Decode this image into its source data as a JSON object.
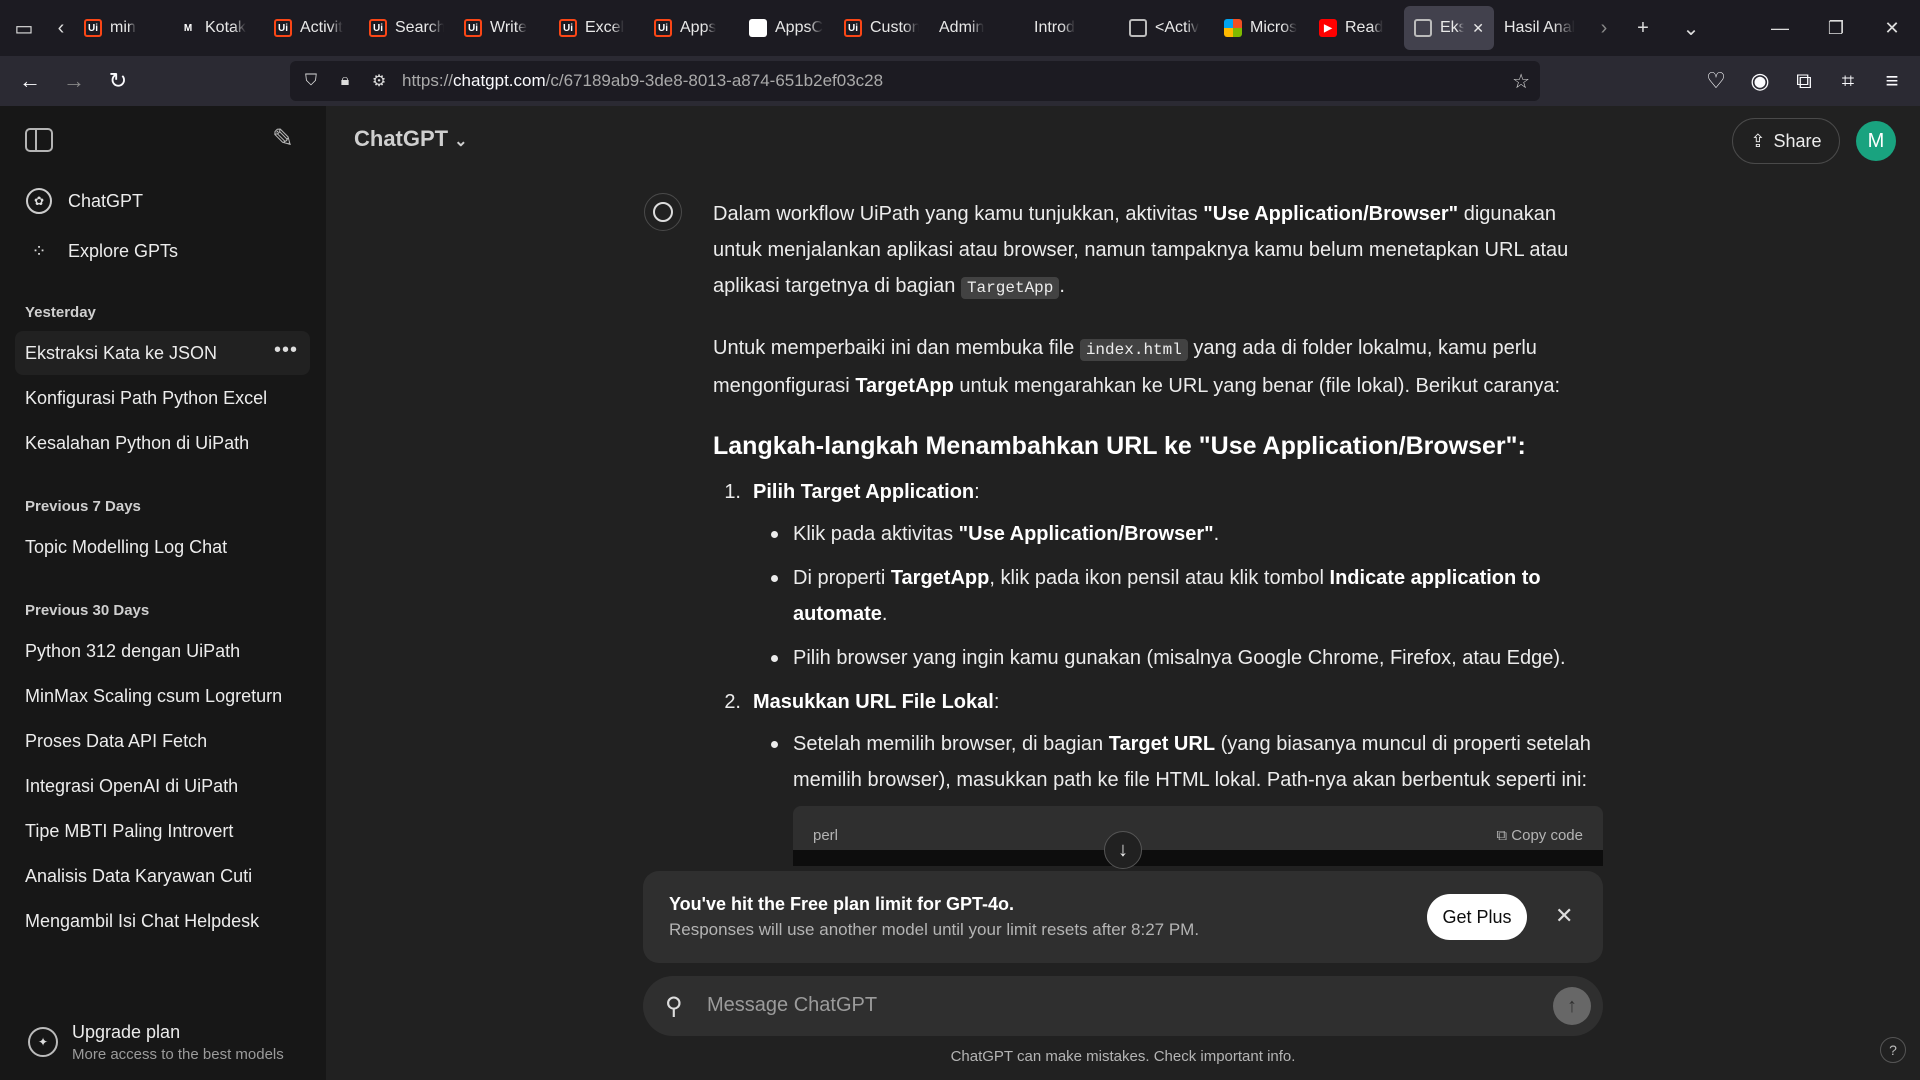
{
  "browser": {
    "tabs": [
      {
        "label": "min",
        "favicon": "uipath-icon"
      },
      {
        "label": "Kotak",
        "favicon": "gmail-icon"
      },
      {
        "label": "Activit",
        "favicon": "uipath-icon"
      },
      {
        "label": "Search",
        "favicon": "uipath-icon"
      },
      {
        "label": "Write",
        "favicon": "uipath-icon"
      },
      {
        "label": "Excel",
        "favicon": "uipath-icon"
      },
      {
        "label": "Apps",
        "favicon": "uipath-icon"
      },
      {
        "label": "AppsC",
        "favicon": "github-icon"
      },
      {
        "label": "Custon",
        "favicon": "uipath-icon"
      },
      {
        "label": "Admin",
        "favicon": "none"
      },
      {
        "label": "Introd",
        "favicon": "none"
      },
      {
        "label": "<Activ",
        "favicon": "openai-icon"
      },
      {
        "label": "Micros",
        "favicon": "microsoft-icon"
      },
      {
        "label": "Read",
        "favicon": "youtube-icon"
      },
      {
        "label": "Eks",
        "favicon": "openai-icon",
        "active": true
      },
      {
        "label": "Hasil Anal",
        "favicon": "none"
      }
    ],
    "url_prefix": "https://",
    "url_host": "chatgpt.com",
    "url_path": "/c/67189ab9-3de8-8013-a874-651b2ef03c28"
  },
  "sidebar": {
    "links": [
      {
        "label": "ChatGPT",
        "icon": "openai-icon"
      },
      {
        "label": "Explore GPTs",
        "icon": "grid-icon"
      }
    ],
    "sections": [
      {
        "title": "Yesterday",
        "items": [
          "Ekstraksi Kata ke JSON",
          "Konfigurasi Path Python Excel",
          "Kesalahan Python di UiPath"
        ]
      },
      {
        "title": "Previous 7 Days",
        "items": [
          "Topic Modelling Log Chat"
        ]
      },
      {
        "title": "Previous 30 Days",
        "items": [
          "Python 312 dengan UiPath",
          "MinMax Scaling csum Logreturn",
          "Proses Data API Fetch",
          "Integrasi OpenAI di UiPath",
          "Tipe MBTI Paling Introvert",
          "Analisis Data Karyawan Cuti",
          "Mengambil Isi Chat Helpdesk"
        ]
      }
    ],
    "upgrade_title": "Upgrade plan",
    "upgrade_sub": "More access to the best models"
  },
  "header": {
    "model": "ChatGPT",
    "share": "Share",
    "avatar_letter": "M"
  },
  "message": {
    "p1_a": "Dalam workflow UiPath yang kamu tunjukkan, aktivitas ",
    "p1_b": "\"Use Application/Browser\"",
    "p1_c": " digunakan untuk menjalankan aplikasi atau browser, namun tampaknya kamu belum menetapkan URL atau aplikasi targetnya di bagian ",
    "p1_code": "TargetApp",
    "p1_d": ".",
    "p2_a": "Untuk memperbaiki ini dan membuka file ",
    "p2_code": "index.html",
    "p2_b": " yang ada di folder lokalmu, kamu perlu mengonfigurasi ",
    "p2_c": "TargetApp",
    "p2_d": " untuk mengarahkan ke URL yang benar (file lokal). Berikut caranya:",
    "h_a": "Langkah-langkah Menambahkan URL ke ",
    "h_b": "\"Use Application/Browser\"",
    "h_c": ":",
    "s1_num": "1.",
    "s1_title": "Pilih Target Application",
    "s1_b1_a": "Klik pada aktivitas ",
    "s1_b1_b": "\"Use Application/Browser\"",
    "s1_b1_c": ".",
    "s1_b2_a": "Di properti ",
    "s1_b2_b": "TargetApp",
    "s1_b2_c": ", klik pada ikon pensil atau klik tombol ",
    "s1_b2_d": "Indicate application to automate",
    "s1_b2_e": ".",
    "s1_b3": "Pilih browser yang ingin kamu gunakan (misalnya Google Chrome, Firefox, atau Edge).",
    "s2_num": "2.",
    "s2_title": "Masukkan URL File Lokal",
    "s2_b1_a": "Setelah memilih browser, di bagian ",
    "s2_b1_b": "Target URL",
    "s2_b1_c": " (yang biasanya muncul di properti setelah memilih browser), masukkan path ke file HTML lokal. Path-nya akan berbentuk seperti ini:",
    "code_lang": "perl",
    "copy_code": "Copy code"
  },
  "limit": {
    "title": "You've hit the Free plan limit for GPT-4o.",
    "sub": "Responses will use another model until your limit resets after 8:27 PM.",
    "button": "Get Plus"
  },
  "composer": {
    "placeholder": "Message ChatGPT",
    "disclaimer": "ChatGPT can make mistakes. Check important info."
  }
}
